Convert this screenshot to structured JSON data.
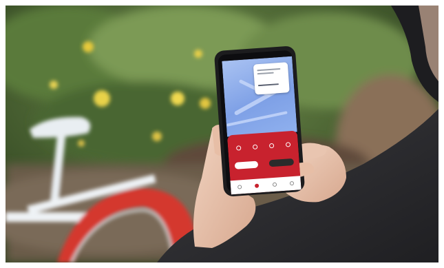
{
  "scene": {
    "description_colors": {
      "foliage": "#3f5a2c",
      "flowers": "#e6c93a",
      "bike_frame": "#e9eef2",
      "bike_tire": "#d4392f",
      "phone_body": "#1c1c1e",
      "app_accent": "#c8222e",
      "map_blue": "#7ea0e6",
      "jacket": "#2f2f33",
      "skin": "#e8c4ad"
    }
  },
  "phone_screen": {
    "map_popup_icon": "location-card-icon",
    "riding_status_text": "",
    "stat_icons": [
      "timer-icon",
      "distance-icon",
      "speed-icon",
      "battery-icon"
    ],
    "left_button_label": "",
    "right_button_label": "",
    "nav_icons": [
      "map-nav-icon",
      "ride-nav-icon",
      "wallet-nav-icon",
      "profile-nav-icon"
    ]
  }
}
